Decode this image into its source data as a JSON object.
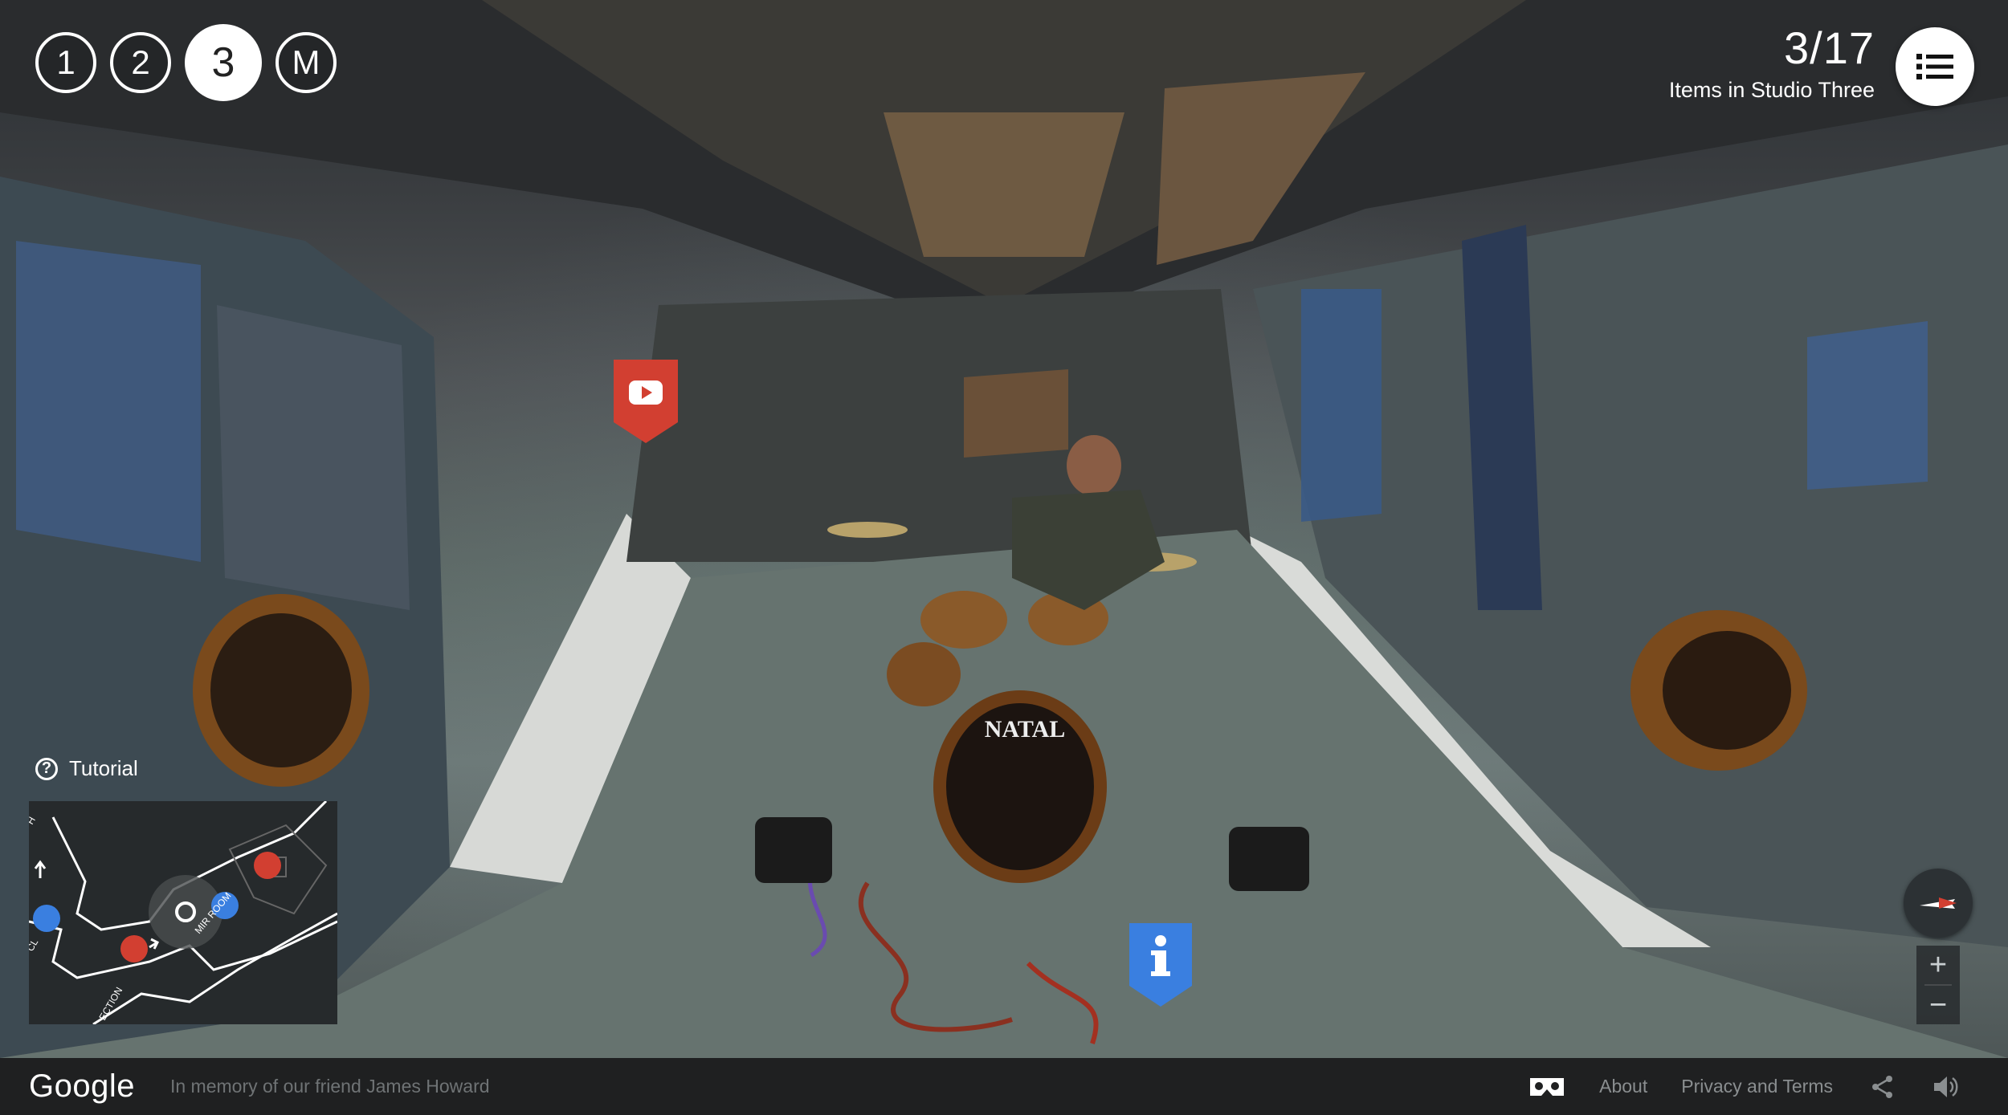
{
  "levels": {
    "items": [
      "1",
      "2",
      "3",
      "M"
    ],
    "active": "3"
  },
  "counter": {
    "value": "3/17",
    "label": "Items in Studio Three"
  },
  "tutorial": {
    "label": "Tutorial",
    "icon": "help-circle-icon"
  },
  "minimap": {
    "labels": [
      "MIR ROOM",
      "ECTION",
      "H",
      "CL"
    ]
  },
  "scene": {
    "drum_brand": "NATAL",
    "video_hotspot_icon": "youtube-play-icon",
    "info_hotspot_icon": "info-icon"
  },
  "zoom": {
    "in_label": "+",
    "out_label": "−"
  },
  "footer": {
    "logo": "Google",
    "memory": "In memory of our friend James Howard",
    "links": [
      "About",
      "Privacy and Terms"
    ],
    "icons": [
      "vr-headset-icon",
      "share-icon",
      "volume-icon"
    ]
  },
  "colors": {
    "video_hotspot": "#d23f31",
    "info_hotspot": "#3a7fe0",
    "map_red": "#d23f31",
    "map_blue": "#3a7fe0",
    "footer_bg": "#1f2021"
  }
}
